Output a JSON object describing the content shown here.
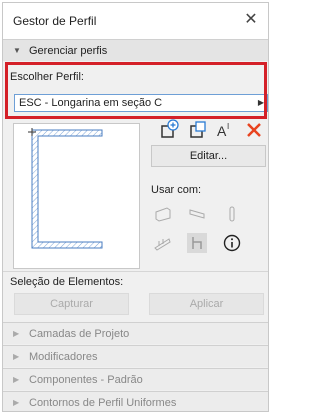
{
  "window": {
    "title": "Gestor de Perfil"
  },
  "section_manage": {
    "label": "Gerenciar perfis"
  },
  "choose_profile": {
    "label": "Escolher Perfil:",
    "selected": "ESC - Longarina em seção C"
  },
  "tools": {
    "edit_label": "Editar...",
    "use_with_label": "Usar com:"
  },
  "selection": {
    "label": "Seleção de Elementos:",
    "capture_label": "Capturar",
    "apply_label": "Aplicar"
  },
  "collapsed_sections": [
    {
      "label": "Camadas de Projeto"
    },
    {
      "label": "Modificadores"
    },
    {
      "label": "Componentes - Padrão"
    },
    {
      "label": "Contornos de Perfil Uniformes"
    }
  ],
  "colors": {
    "highlight": "#d42028",
    "accent": "#2a7bd4",
    "delete": "#e8431f"
  }
}
